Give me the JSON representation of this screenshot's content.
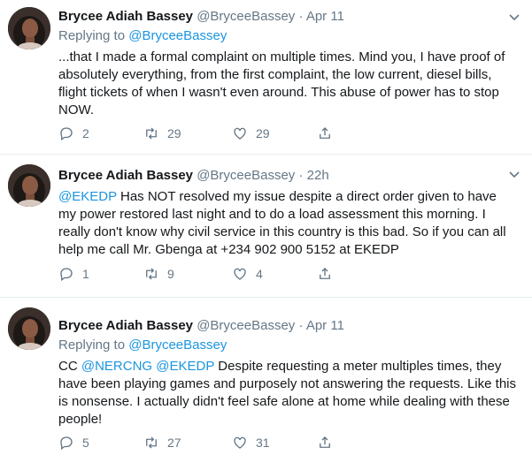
{
  "tweets": [
    {
      "name": "Brycee Adiah Bassey",
      "handle": "@BryceeBassey",
      "dot": "·",
      "time": "Apr 11",
      "replying_prefix": "Replying to ",
      "replying_handle": "@BryceeBassey",
      "text_parts": [
        {
          "t": "...that I made a formal complaint on multiple times. Mind you, I have proof of absolutely everything, from the first complaint, the low current, diesel bills, flight tickets of when I wasn't even around. This abuse of power has to stop NOW.",
          "m": false
        }
      ],
      "replies": "2",
      "retweets": "29",
      "likes": "29"
    },
    {
      "name": "Brycee Adiah Bassey",
      "handle": "@BryceeBassey",
      "dot": "·",
      "time": "22h",
      "text_parts": [
        {
          "t": "@EKEDP",
          "m": true
        },
        {
          "t": " Has NOT resolved my issue despite a direct order given to have my power restored last night and to do a load assessment this morning. I really don't know why civil service in this country is this bad. So if you can all help me call Mr. Gbenga at +234 902 900 5152 at EKEDP",
          "m": false
        }
      ],
      "replies": "1",
      "retweets": "9",
      "likes": "4"
    },
    {
      "name": "Brycee Adiah Bassey",
      "handle": "@BryceeBassey",
      "dot": "·",
      "time": "Apr 11",
      "replying_prefix": "Replying to ",
      "replying_handle": "@BryceeBassey",
      "text_parts": [
        {
          "t": "CC ",
          "m": false
        },
        {
          "t": "@NERCNG",
          "m": true
        },
        {
          "t": " ",
          "m": false
        },
        {
          "t": "@EKEDP",
          "m": true
        },
        {
          "t": " Despite requesting a meter multiples times, they have been playing games and purposely not answering the requests. Like this is nonsense. I actually didn't feel safe alone at home while dealing with these people!",
          "m": false
        }
      ],
      "replies": "5",
      "retweets": "27",
      "likes": "31"
    }
  ],
  "icons": {
    "reply": "reply-icon",
    "retweet": "retweet-icon",
    "like": "heart-icon",
    "share": "share-icon",
    "more": "chevron-down-icon"
  },
  "colors": {
    "link": "#1b95e0",
    "secondary": "#657786",
    "divider": "#e6ecf0"
  }
}
